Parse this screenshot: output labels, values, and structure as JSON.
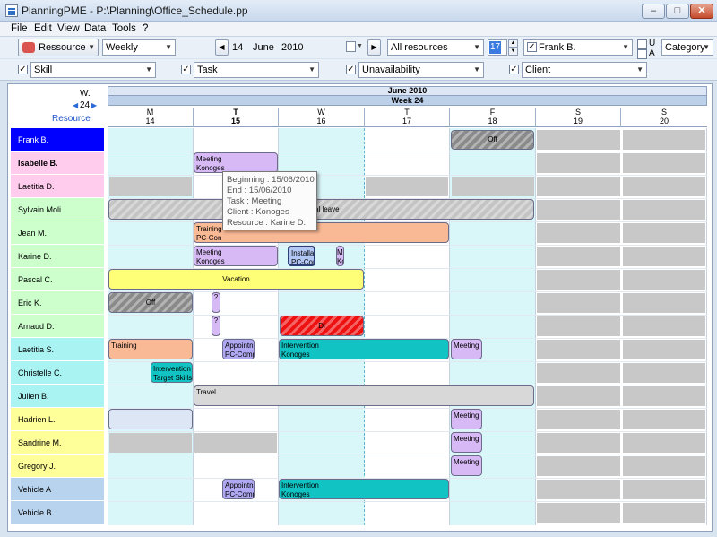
{
  "window": {
    "title": "PlanningPME - P:\\Planning\\Office_Schedule.pp",
    "minimize": "–",
    "maximize": "□",
    "close": "✕"
  },
  "menu": [
    "File",
    "Edit",
    "View",
    "Data",
    "Tools",
    "?"
  ],
  "toolbar": {
    "resource_button": "Ressource",
    "view_mode": "Weekly",
    "date_day": "14",
    "date_month": "June",
    "date_year": "2010",
    "resources_filter": "All resources",
    "count_value": "17",
    "person_filter": "Frank B.",
    "opt_u": "U",
    "opt_a": "A",
    "category": "Category"
  },
  "filters": [
    "Skill",
    "Task",
    "Unavailability",
    "Client"
  ],
  "header": {
    "month": "June 2010",
    "week": "Week 24",
    "w_label": "W.",
    "w_value": "24",
    "resource_label": "Resource",
    "days": [
      {
        "letter": "M",
        "num": "14"
      },
      {
        "letter": "T",
        "num": "15"
      },
      {
        "letter": "W",
        "num": "16"
      },
      {
        "letter": "T",
        "num": "17"
      },
      {
        "letter": "F",
        "num": "18"
      },
      {
        "letter": "S",
        "num": "19"
      },
      {
        "letter": "S",
        "num": "20"
      }
    ]
  },
  "resources": [
    {
      "name": "Frank B.",
      "color": "#0000ff",
      "text": "#ffffff"
    },
    {
      "name": "Isabelle B.",
      "color": "#ffccee",
      "text": "#000000",
      "bold": true
    },
    {
      "name": "Laetitia D.",
      "color": "#ffccee",
      "text": "#000000"
    },
    {
      "name": "Sylvain Moli",
      "color": "#ccffcc",
      "text": "#000000"
    },
    {
      "name": "Jean M.",
      "color": "#ccffcc",
      "text": "#000000"
    },
    {
      "name": "Karine D.",
      "color": "#ccffcc",
      "text": "#000000"
    },
    {
      "name": "Pascal C.",
      "color": "#ccffcc",
      "text": "#000000"
    },
    {
      "name": "Eric K.",
      "color": "#ccffcc",
      "text": "#000000"
    },
    {
      "name": "Arnaud D.",
      "color": "#ccffcc",
      "text": "#000000"
    },
    {
      "name": "Laetitia S.",
      "color": "#aaf3f3",
      "text": "#000000"
    },
    {
      "name": "Christelle C.",
      "color": "#aaf3f3",
      "text": "#000000"
    },
    {
      "name": "Julien B.",
      "color": "#aaf3f3",
      "text": "#000000"
    },
    {
      "name": "Hadrien L.",
      "color": "#ffff99",
      "text": "#000000"
    },
    {
      "name": "Sandrine M.",
      "color": "#ffff99",
      "text": "#000000"
    },
    {
      "name": "Gregory J.",
      "color": "#ffff99",
      "text": "#000000"
    },
    {
      "name": "Vehicle A",
      "color": "#b7d3ee",
      "text": "#000000"
    },
    {
      "name": "Vehicle B",
      "color": "#b7d3ee",
      "text": "#000000"
    }
  ],
  "events": {
    "frank_off": "Off",
    "isabelle_meeting": "Meeting",
    "isabelle_client": "Konoges",
    "sylvain_leave": "al leave",
    "jean_training": "Training",
    "jean_client": "PC-Con",
    "karine_meeting": "Meeting",
    "karine_client": "Konoges",
    "karine_install": "Installat",
    "karine_install_client": "PC-Com",
    "karine_m": "M",
    "karine_k": "Ko",
    "pascal_vacation": "Vacation",
    "eric_off": "Off",
    "eric_mark": "?",
    "arnaud_mark": "?",
    "arnaud_red": "Di",
    "laetitias_training": "Training",
    "laetitias_appoint": "Appointn",
    "laetitias_appoint_client": "PC-Comp",
    "laetitias_intervention": "Intervention",
    "laetitias_intervention_client": "Konoges",
    "laetitias_meeting": "Meeting",
    "christelle_intervention": "Intervention",
    "christelle_skills": "Target Skills",
    "julien_travel": "Travel",
    "hadrien_meeting": "Meeting",
    "sandrine_meeting": "Meeting",
    "gregory_meeting": "Meeting",
    "vehicle_appoint": "Appointn",
    "vehicle_appoint_client": "PC-Comp",
    "vehicle_intervention": "Intervention",
    "vehicle_intervention_client": "Konoges"
  },
  "tooltip": {
    "beginning": "Beginning : 15/06/2010",
    "end": "End : 15/06/2010",
    "task": "Task : Meeting",
    "client": "Client : Konoges",
    "resource": "Resource : Karine D."
  }
}
